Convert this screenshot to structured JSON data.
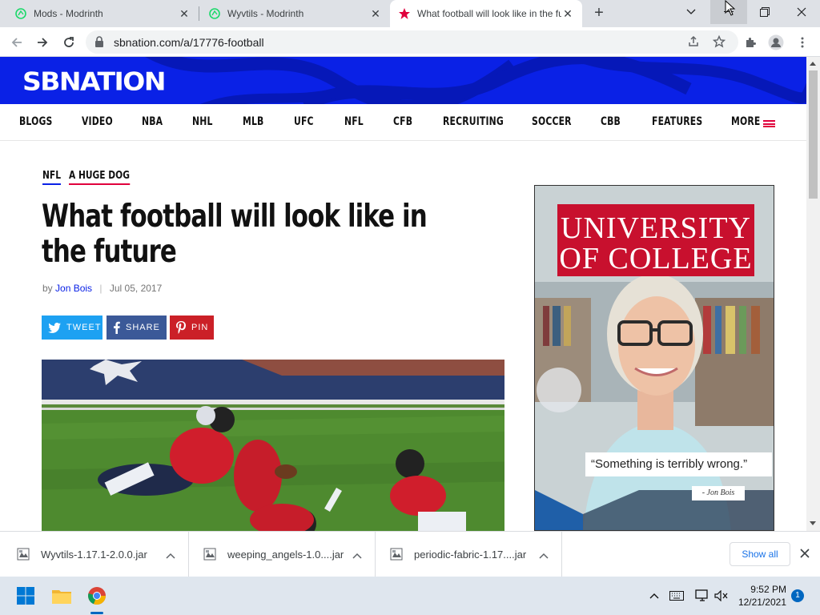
{
  "tabs": [
    {
      "title": "Mods - Modrinth",
      "active": false
    },
    {
      "title": "Wyvtils - Modrinth",
      "active": false
    },
    {
      "title": "What football will look like in the future",
      "active": true
    }
  ],
  "address_bar": {
    "url": "sbnation.com/a/17776-football"
  },
  "site": {
    "logo": "SBNATION",
    "nav": [
      "BLOGS",
      "VIDEO",
      "NBA",
      "NHL",
      "MLB",
      "UFC",
      "NFL",
      "CFB",
      "RECRUITING",
      "SOCCER",
      "CBB",
      "FEATURES",
      "MORE"
    ]
  },
  "article": {
    "tags": [
      "NFL",
      "A HUGE DOG"
    ],
    "headline": "What football will look like in the future",
    "byline_prefix": "by",
    "author": "Jon Bois",
    "byline_separator": "|",
    "date": "Jul 05, 2017",
    "share": [
      {
        "label": "TWEET",
        "color": "#1da1f2"
      },
      {
        "label": "SHARE",
        "color": "#3b5998"
      },
      {
        "label": "PIN",
        "color": "#cb2027"
      }
    ]
  },
  "ad": {
    "logo_line1": "UNIVERSITY",
    "logo_line2": "OF COLLEGE",
    "quote": "“Something is terribly wrong.”",
    "signature": "- Jon Bois"
  },
  "downloads": {
    "items": [
      "Wyvtils-1.17.1-2.0.0.jar",
      "weeping_angels-1.0....jar",
      "periodic-fabric-1.17....jar"
    ],
    "show_all": "Show all"
  },
  "taskbar": {
    "time": "9:52 PM",
    "date": "12/21/2021",
    "notifications": "1"
  },
  "colors": {
    "sbnation_blue": "#0a21e6",
    "accent_red": "#e0003c",
    "ad_red": "#c8102e",
    "link_blue": "#1a73e8"
  }
}
